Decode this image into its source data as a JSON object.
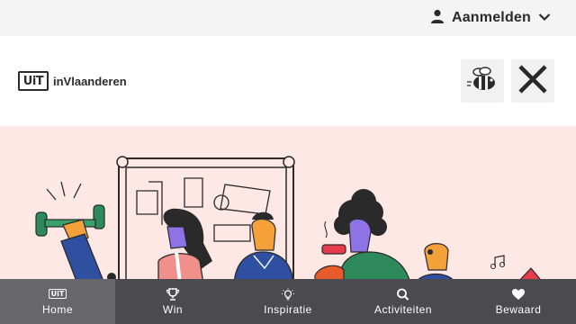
{
  "topbar": {
    "login_label": "Aanmelden"
  },
  "header": {
    "logo_mark": "UiT",
    "logo_text": "inVlaanderen"
  },
  "nav": {
    "home_mark": "UiT",
    "items": [
      {
        "label": "Home",
        "icon": "uit-logo-icon",
        "active": true
      },
      {
        "label": "Win",
        "icon": "trophy-icon",
        "active": false
      },
      {
        "label": "Inspiratie",
        "icon": "lightbulb-icon",
        "active": false
      },
      {
        "label": "Activiteiten",
        "icon": "search-icon",
        "active": false
      },
      {
        "label": "Bewaard",
        "icon": "heart-icon",
        "active": false
      }
    ]
  },
  "colors": {
    "hero_bg": "#fde8e5",
    "nav_bg": "#4a4a4f",
    "nav_active": "#66666b"
  }
}
